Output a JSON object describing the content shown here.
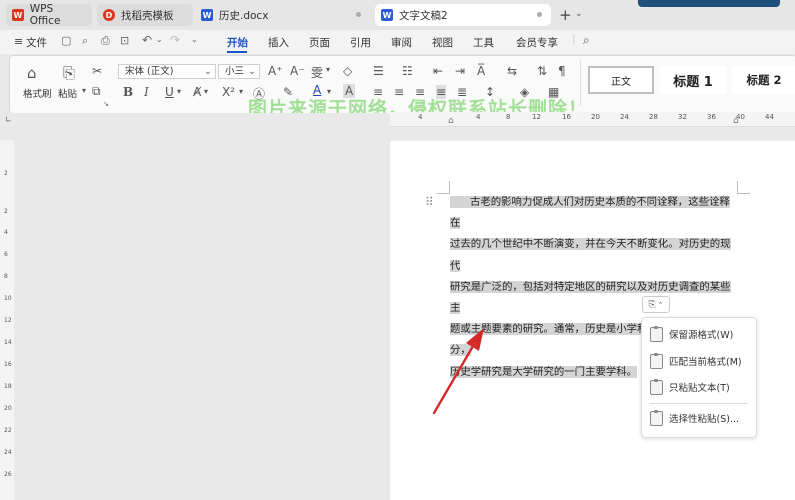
{
  "tabs": [
    {
      "label": "WPS Office",
      "icon": "wps-logo-icon"
    },
    {
      "label": "找稻壳模板",
      "icon": "docer-icon"
    },
    {
      "label": "历史.docx",
      "icon": "word-doc-icon"
    },
    {
      "label": "文字文稿2",
      "icon": "word-doc-icon",
      "active": true
    }
  ],
  "menu": {
    "file": "文件",
    "items": [
      "开始",
      "插入",
      "页面",
      "引用",
      "审阅",
      "视图",
      "工具",
      "会员专享"
    ],
    "active": "开始"
  },
  "ribbon": {
    "format_painter": "格式刷",
    "paste": "粘贴",
    "font_name": "宋体 (正文)",
    "font_size": "小三",
    "style_normal": "正文",
    "style_h1": "标题  1",
    "style_h2": "标题  2",
    "bold": "B",
    "italic": "I",
    "underline": "U",
    "font_color": "A",
    "char_shade": "A"
  },
  "watermark": "图片来源于网络，侵权联系站长删除！",
  "ruler_numbers": [
    "4",
    "4",
    "8",
    "12",
    "16",
    "20",
    "24",
    "28",
    "32",
    "36",
    "40",
    "44"
  ],
  "vruler_numbers": [
    "2",
    "2",
    "4",
    "6",
    "8",
    "10",
    "12",
    "14",
    "16",
    "18",
    "20",
    "22",
    "24",
    "26"
  ],
  "document": {
    "lines": [
      "古老的影响力促成人们对历史本质的不同诠释，这些诠释在",
      "过去的几个世纪中不断演变，并在今天不断变化。对历史的现代",
      "研究是广泛的，包括对特定地区的研究以及对历史调查的某些主",
      "题或主题要素的研究。通常，历史是小学和中学教育的一部分，",
      "历史学研究是大学研究的一门主要学科。"
    ]
  },
  "paste_menu": {
    "items": [
      "保留源格式(W)",
      "匹配当前格式(M)",
      "只粘贴文本(T)",
      "选择性粘贴(S)..."
    ]
  },
  "colors": {
    "accent": "#1a56c6",
    "arrow": "#d42a2a",
    "wps_red": "#e0341e",
    "word_blue": "#2b5bd7"
  }
}
